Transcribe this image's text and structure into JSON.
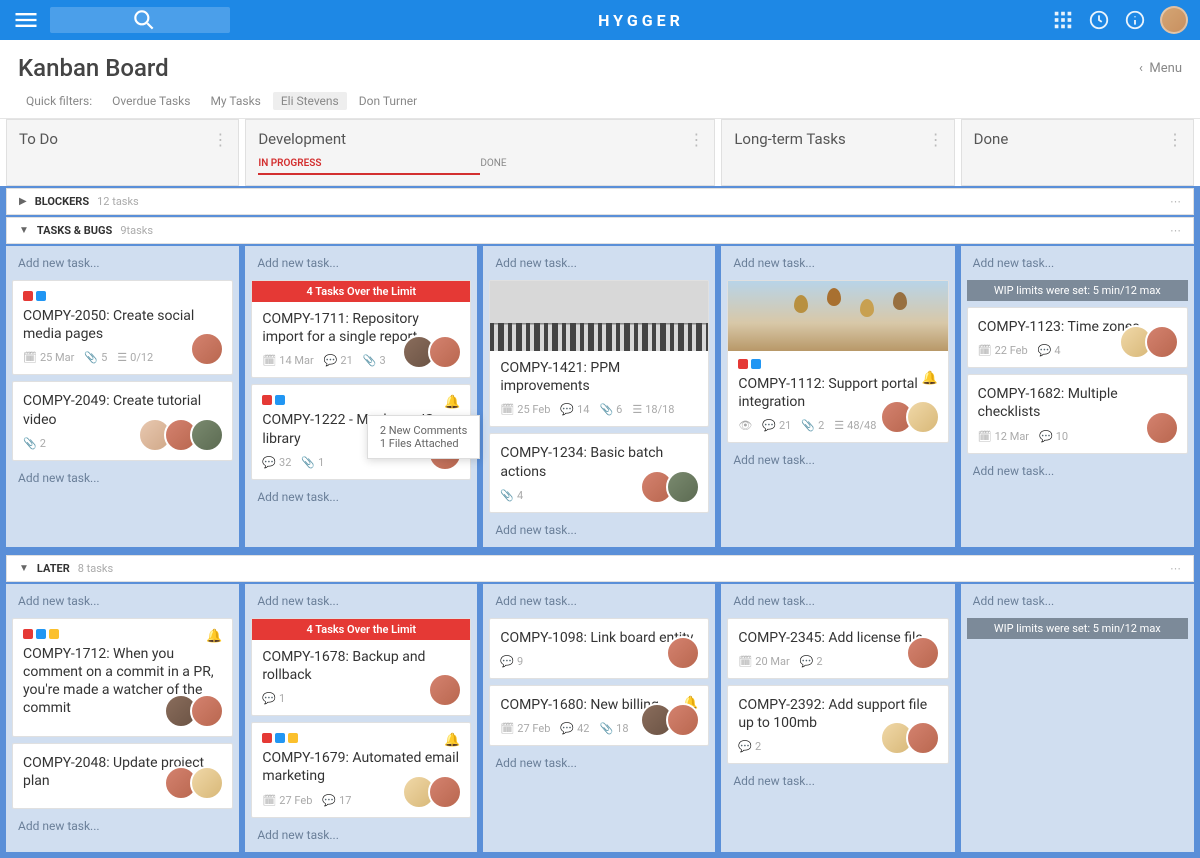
{
  "brand": "HYGGER",
  "menuLabel": "Menu",
  "boardTitle": "Kanban Board",
  "filterLabel": "Quick filters:",
  "filters": [
    "Overdue Tasks",
    "My Tasks",
    "Eli Stevens",
    "Don Turner"
  ],
  "activeFilter": 2,
  "columns": {
    "todo": "To Do",
    "dev": "Development",
    "devSub1": "IN PROGRESS",
    "devSub2": "DONE",
    "long": "Long-term Tasks",
    "done": "Done"
  },
  "swimlanes": {
    "blockers": {
      "name": "BLOCKERS",
      "count": "12 tasks"
    },
    "tasks": {
      "name": "TASKS & BUGS",
      "count": "9tasks"
    },
    "later": {
      "name": "LATER",
      "count": "8 tasks"
    }
  },
  "addTask": "Add new task...",
  "warnBanner": "4 Tasks Over the Limit",
  "wipBanner": "WIP limits were set: 5 min/12 max",
  "tooltip": {
    "l1": "2 New Comments",
    "l2": "1 Files Attached"
  },
  "colors": {
    "red": "#e53935",
    "blue": "#2196f3",
    "yellow": "#fbc02d"
  },
  "cards": {
    "c2050": {
      "title": "COMPY-2050: Create social media pages",
      "date": "25 Mar",
      "att": "5",
      "check": "0/12"
    },
    "c2049": {
      "title": "COMPY-2049: Create tutorial video",
      "att": "2"
    },
    "c1711": {
      "title": "COMPY-1711: Repository import for a single report",
      "date": "14 Mar",
      "com": "21",
      "att": "3"
    },
    "c1222": {
      "title": "COMPY-1222 - Mashups JS library",
      "com": "32",
      "att": "1"
    },
    "c1421": {
      "title": "COMPY-1421: PPM improvements",
      "date": "25 Feb",
      "com": "14",
      "att": "6",
      "check": "18/18"
    },
    "c1234": {
      "title": "COMPY-1234: Basic batch actions",
      "att": "4"
    },
    "c1112": {
      "title": "COMPY-1112: Support portal integration",
      "com": "21",
      "att": "2",
      "check": "48/48"
    },
    "c1123": {
      "title": "COMPY-1123: Time zones",
      "date": "22 Feb",
      "com": "4"
    },
    "c1682": {
      "title": "COMPY-1682: Multiple checklists",
      "date": "12 Mar",
      "com": "10"
    },
    "c1712": {
      "title": "COMPY-1712: When you comment on a commit in a PR, you're made a watcher of the commit"
    },
    "c2048": {
      "title": "COMPY-2048: Update project plan"
    },
    "c1678": {
      "title": "COMPY-1678: Backup and rollback",
      "com": "1"
    },
    "c1679": {
      "title": "COMPY-1679: Automated email marketing",
      "date": "27 Feb",
      "com": "17"
    },
    "c1098": {
      "title": "COMPY-1098: Link board entity",
      "com": "9"
    },
    "c1680": {
      "title": "COMPY-1680: New billing",
      "date": "27 Feb",
      "com": "42",
      "att": "18"
    },
    "c2345": {
      "title": "COMPY-2345: Add license file",
      "date": "20 Mar",
      "com": "2"
    },
    "c2392": {
      "title": "COMPY-2392: Add support file up to 100mb",
      "com": "2"
    }
  }
}
